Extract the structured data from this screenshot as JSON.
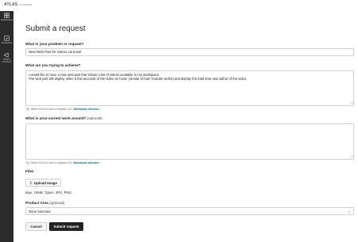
{
  "brand": {
    "logo_text": "ATLAS",
    "logo_sub": "ENTERPRISE"
  },
  "sidebar": {
    "items": [
      {
        "label": "Dashboard",
        "icon": "dashboard-icon"
      },
      {
        "label": "Requests",
        "icon": "requests-icon"
      },
      {
        "label": "What's Coming?",
        "icon": "megaphone-icon"
      }
    ]
  },
  "page": {
    "title": "Submit a request"
  },
  "form": {
    "problem": {
      "label": "What is your problem or request?",
      "value": "New Web Part for videos carousel"
    },
    "goal": {
      "label": "What are you trying to achieve?",
      "value": "I would like to have a new web part that shows a list of videos available in my workspace.\nThe web part will display inline a few seconds of the video on hover (similar of how Youtube works) and display the total time and author of the video.",
      "tip_prefix": "Tip: Write #123 to link to request 123. ",
      "tip_markdown": "Markdown allowed."
    },
    "workaround": {
      "label": "What is your current work around?",
      "optional": "(optional)",
      "value": "",
      "tip_prefix": "Tip: Write #123 to link to request 123. ",
      "tip_markdown": "Markdown allowed."
    },
    "files": {
      "label": "Files",
      "upload_label": "Upload Image",
      "note": "Max: 10MB. Types: JPG, PNG"
    },
    "product_area": {
      "label": "Product Area",
      "optional": "(optional)",
      "selected": "None Selected"
    },
    "actions": {
      "cancel": "Cancel",
      "submit": "Submit request"
    }
  },
  "colors": {
    "sidebar_bg": "#2b2b2b",
    "primary_button": "#222222",
    "markdown_link": "#1a6f8a"
  }
}
